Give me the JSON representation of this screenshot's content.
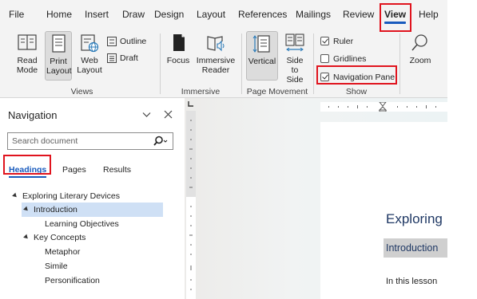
{
  "menu": {
    "items": [
      "File",
      "Home",
      "Insert",
      "Draw",
      "Design",
      "Layout",
      "References",
      "Mailings",
      "Review",
      "View",
      "Help"
    ],
    "active": "View"
  },
  "ribbon": {
    "views": {
      "read_mode": "Read Mode",
      "print_layout": "Print Layout",
      "web_layout": "Web Layout",
      "outline": "Outline",
      "draft": "Draft",
      "group_label": "Views"
    },
    "immersive": {
      "focus": "Focus",
      "immersive_reader": "Immersive Reader",
      "group_label": "Immersive"
    },
    "page_movement": {
      "vertical": "Vertical",
      "side_to_side": "Side to Side",
      "group_label": "Page Movement"
    },
    "show": {
      "ruler": {
        "label": "Ruler",
        "checked": true
      },
      "gridlines": {
        "label": "Gridlines",
        "checked": false
      },
      "navigation_pane": {
        "label": "Navigation Pane",
        "checked": true
      },
      "group_label": "Show"
    },
    "zoom": {
      "label": "Zoom"
    }
  },
  "nav": {
    "title": "Navigation",
    "search_placeholder": "Search document",
    "tabs": [
      "Headings",
      "Pages",
      "Results"
    ],
    "active_tab": "Headings",
    "tree": [
      {
        "label": "Exploring Literary Devices",
        "level": 0,
        "expanded": true
      },
      {
        "label": "Introduction",
        "level": 1,
        "expanded": true,
        "selected": true
      },
      {
        "label": "Learning Objectives",
        "level": 2
      },
      {
        "label": "Key Concepts",
        "level": 1,
        "expanded": true
      },
      {
        "label": "Metaphor",
        "level": 2
      },
      {
        "label": "Simile",
        "level": 2
      },
      {
        "label": "Personification",
        "level": 2
      }
    ]
  },
  "document": {
    "title": "Exploring Literary Devices",
    "heading": "Introduction",
    "body": "In this lesson"
  },
  "colors": {
    "accent": "#185abd",
    "highlight": "#e0141e",
    "selected_row": "#cfe0f5"
  }
}
